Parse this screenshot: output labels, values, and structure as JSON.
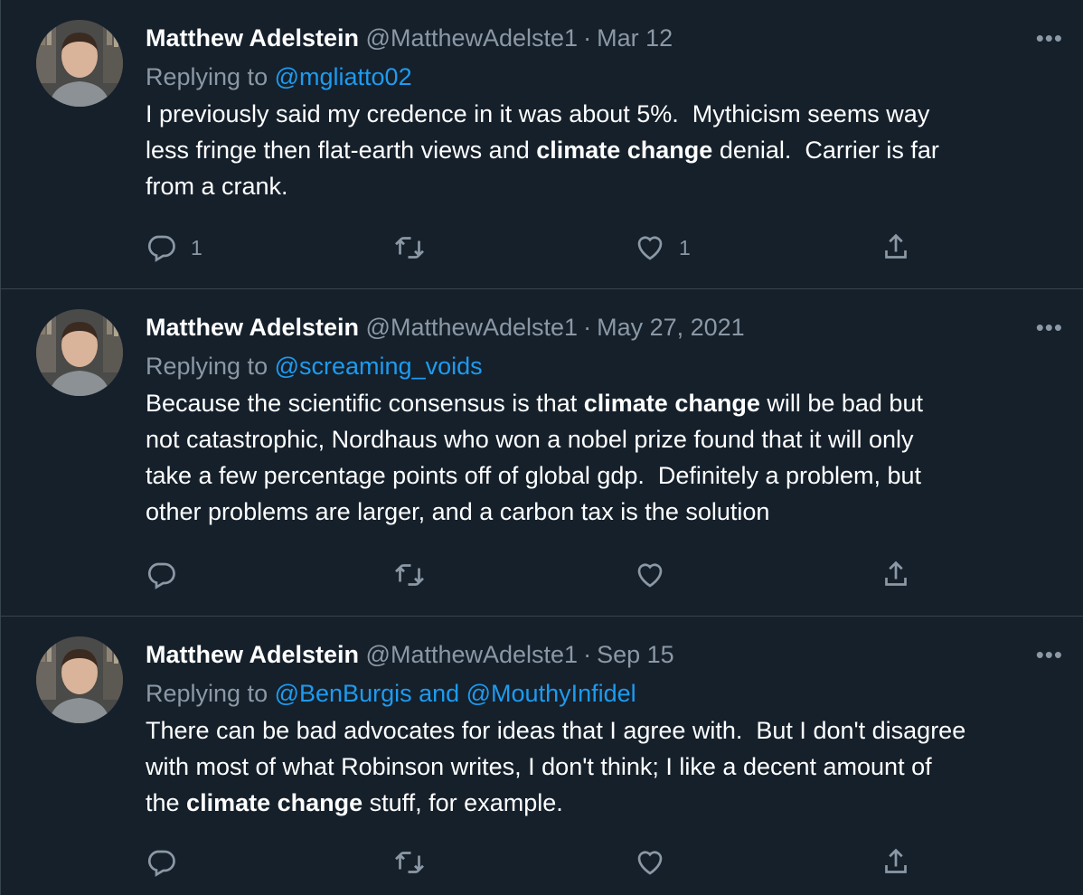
{
  "tweets": [
    {
      "author_name": "Matthew Adelstein",
      "handle": "@MatthewAdelste1",
      "separator": "·",
      "date": "Mar 12",
      "more": "•••",
      "replying_prefix": "Replying to",
      "replying_to": "@mgliatto02",
      "text_parts": [
        "I previously said my credence in it was about 5%.  Mythicism seems way\nless fringe then flat-earth views and ",
        "climate change",
        " denial.  Carrier is far\nfrom a crank."
      ],
      "reply_count": "1",
      "retweet_count": "",
      "like_count": "1"
    },
    {
      "author_name": "Matthew Adelstein",
      "handle": "@MatthewAdelste1",
      "separator": "·",
      "date": "May 27, 2021",
      "more": "•••",
      "replying_prefix": "Replying to",
      "replying_to": "@screaming_voids",
      "text_parts": [
        "Because the scientific consensus is that ",
        "climate change",
        " will be bad but\nnot catastrophic, Nordhaus who won a nobel prize found that it will only\ntake a few percentage points off of global gdp.  Definitely a problem, but\nother problems are larger, and a carbon tax is the solution"
      ],
      "reply_count": "",
      "retweet_count": "",
      "like_count": ""
    },
    {
      "author_name": "Matthew Adelstein",
      "handle": "@MatthewAdelste1",
      "separator": "·",
      "date": "Sep 15",
      "more": "•••",
      "replying_prefix": "Replying to",
      "replying_to": "@BenBurgis and @MouthyInfidel",
      "text_parts": [
        "There can be bad advocates for ideas that I agree with.  But I don't disagree\nwith most of what Robinson writes, I don't think; I like a decent amount of\nthe ",
        "climate change",
        " stuff, for example."
      ],
      "reply_count": "",
      "retweet_count": "",
      "like_count": ""
    }
  ],
  "icons": {
    "reply": "reply-icon",
    "retweet": "retweet-icon",
    "like": "like-icon",
    "share": "share-icon",
    "more": "more-icon"
  },
  "colors": {
    "background": "#15202b",
    "border": "#38444d",
    "secondary_text": "#8b98a5",
    "link": "#1d9bf0",
    "primary_text": "#ffffff"
  }
}
